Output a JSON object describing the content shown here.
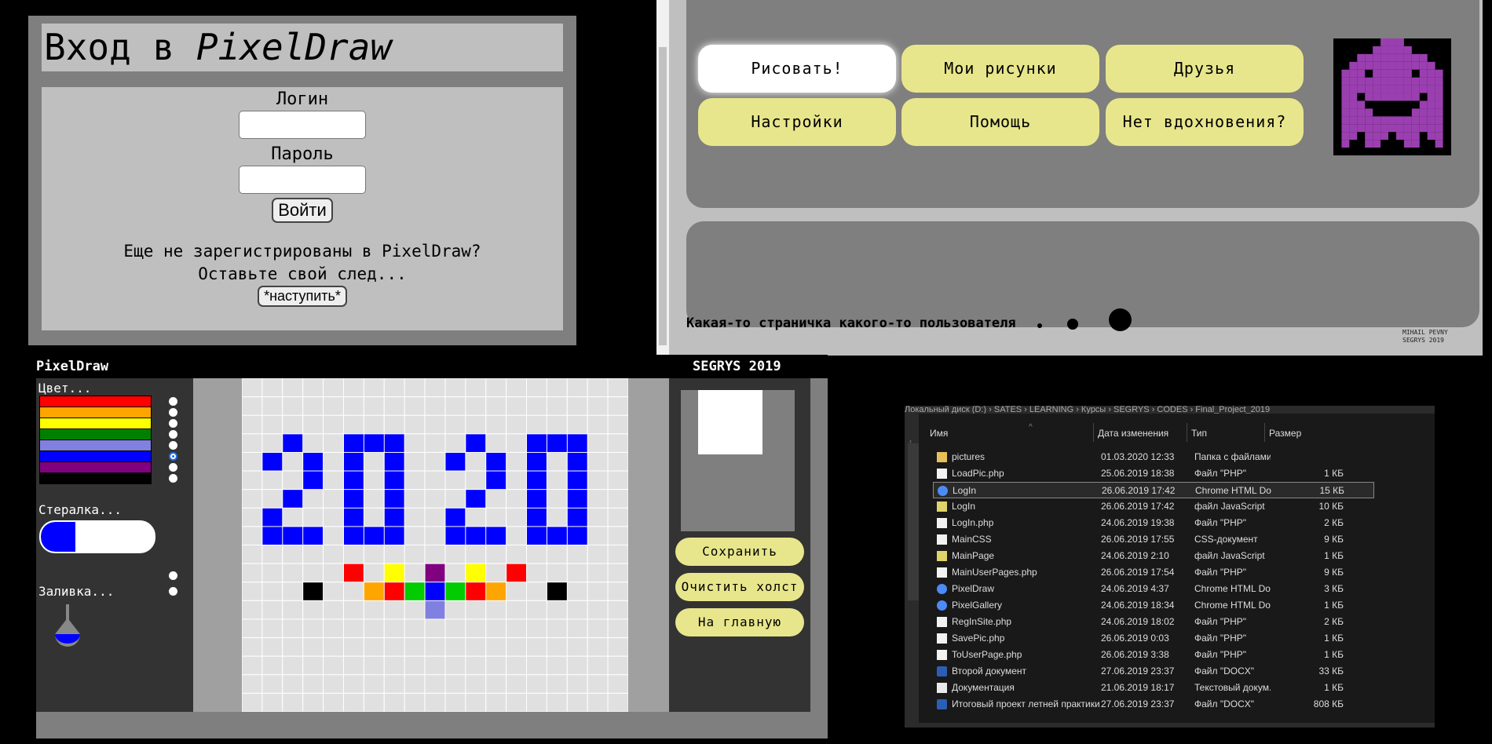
{
  "login": {
    "title_plain": "Вход в ",
    "title_italic": "PixelDraw",
    "login_label": "Логин",
    "password_label": "Пароль",
    "submit_label": "Войти",
    "register_line1": "Еще не зарегистрированы в PixelDraw?",
    "register_line2": "Оставьте свой след...",
    "register_button": "*наступить*"
  },
  "main": {
    "menu": [
      "Рисовать!",
      "Мои рисунки",
      "Друзья",
      "Настройки",
      "Помощь",
      "Нет вдохновения?"
    ],
    "active_menu_index": 0,
    "avatar_color": "#9a3fb0",
    "footer_text": "Какая-то страничка какого-то пользователя",
    "author_line1": "MIHAIL PEVNY",
    "author_line2": "SEGRYS 2019"
  },
  "draw": {
    "app_name": "PixelDraw",
    "header_right": "SEGRYS 2019",
    "color_label": "Цвет...",
    "eraser_label": "Стералка...",
    "fill_label": "Заливка...",
    "palette": [
      "#ff0000",
      "#ffa500",
      "#ffff00",
      "#008000",
      "#8080e0",
      "#0000ff",
      "#800080",
      "#000000"
    ],
    "selected_color_index": 5,
    "save_button": "Сохранить",
    "clear_button": "Очистить холст",
    "home_button": "На главную",
    "canvas_grid": {
      "cols": 19,
      "rows": 18
    },
    "pixels": [
      {
        "c": 2,
        "r": 3,
        "color": "#0000ff"
      },
      {
        "c": 1,
        "r": 4,
        "color": "#0000ff"
      },
      {
        "c": 3,
        "r": 4,
        "color": "#0000ff"
      },
      {
        "c": 3,
        "r": 5,
        "color": "#0000ff"
      },
      {
        "c": 2,
        "r": 6,
        "color": "#0000ff"
      },
      {
        "c": 1,
        "r": 7,
        "color": "#0000ff"
      },
      {
        "c": 1,
        "r": 8,
        "color": "#0000ff"
      },
      {
        "c": 2,
        "r": 8,
        "color": "#0000ff"
      },
      {
        "c": 3,
        "r": 8,
        "color": "#0000ff"
      },
      {
        "c": 5,
        "r": 3,
        "color": "#0000ff"
      },
      {
        "c": 6,
        "r": 3,
        "color": "#0000ff"
      },
      {
        "c": 7,
        "r": 3,
        "color": "#0000ff"
      },
      {
        "c": 5,
        "r": 4,
        "color": "#0000ff"
      },
      {
        "c": 7,
        "r": 4,
        "color": "#0000ff"
      },
      {
        "c": 5,
        "r": 5,
        "color": "#0000ff"
      },
      {
        "c": 7,
        "r": 5,
        "color": "#0000ff"
      },
      {
        "c": 5,
        "r": 6,
        "color": "#0000ff"
      },
      {
        "c": 7,
        "r": 6,
        "color": "#0000ff"
      },
      {
        "c": 5,
        "r": 7,
        "color": "#0000ff"
      },
      {
        "c": 7,
        "r": 7,
        "color": "#0000ff"
      },
      {
        "c": 5,
        "r": 8,
        "color": "#0000ff"
      },
      {
        "c": 6,
        "r": 8,
        "color": "#0000ff"
      },
      {
        "c": 7,
        "r": 8,
        "color": "#0000ff"
      },
      {
        "c": 11,
        "r": 3,
        "color": "#0000ff"
      },
      {
        "c": 10,
        "r": 4,
        "color": "#0000ff"
      },
      {
        "c": 12,
        "r": 4,
        "color": "#0000ff"
      },
      {
        "c": 12,
        "r": 5,
        "color": "#0000ff"
      },
      {
        "c": 11,
        "r": 6,
        "color": "#0000ff"
      },
      {
        "c": 10,
        "r": 7,
        "color": "#0000ff"
      },
      {
        "c": 10,
        "r": 8,
        "color": "#0000ff"
      },
      {
        "c": 11,
        "r": 8,
        "color": "#0000ff"
      },
      {
        "c": 12,
        "r": 8,
        "color": "#0000ff"
      },
      {
        "c": 14,
        "r": 3,
        "color": "#0000ff"
      },
      {
        "c": 15,
        "r": 3,
        "color": "#0000ff"
      },
      {
        "c": 16,
        "r": 3,
        "color": "#0000ff"
      },
      {
        "c": 14,
        "r": 4,
        "color": "#0000ff"
      },
      {
        "c": 16,
        "r": 4,
        "color": "#0000ff"
      },
      {
        "c": 14,
        "r": 5,
        "color": "#0000ff"
      },
      {
        "c": 16,
        "r": 5,
        "color": "#0000ff"
      },
      {
        "c": 14,
        "r": 6,
        "color": "#0000ff"
      },
      {
        "c": 16,
        "r": 6,
        "color": "#0000ff"
      },
      {
        "c": 14,
        "r": 7,
        "color": "#0000ff"
      },
      {
        "c": 16,
        "r": 7,
        "color": "#0000ff"
      },
      {
        "c": 14,
        "r": 8,
        "color": "#0000ff"
      },
      {
        "c": 15,
        "r": 8,
        "color": "#0000ff"
      },
      {
        "c": 16,
        "r": 8,
        "color": "#0000ff"
      },
      {
        "c": 5,
        "r": 10,
        "color": "#ff0000"
      },
      {
        "c": 7,
        "r": 10,
        "color": "#ffff00"
      },
      {
        "c": 9,
        "r": 10,
        "color": "#800080"
      },
      {
        "c": 11,
        "r": 10,
        "color": "#ffff00"
      },
      {
        "c": 13,
        "r": 10,
        "color": "#ff0000"
      },
      {
        "c": 3,
        "r": 11,
        "color": "#000000"
      },
      {
        "c": 6,
        "r": 11,
        "color": "#ffa500"
      },
      {
        "c": 7,
        "r": 11,
        "color": "#ff0000"
      },
      {
        "c": 8,
        "r": 11,
        "color": "#00cc00"
      },
      {
        "c": 9,
        "r": 11,
        "color": "#0000ff"
      },
      {
        "c": 10,
        "r": 11,
        "color": "#00cc00"
      },
      {
        "c": 11,
        "r": 11,
        "color": "#ff0000"
      },
      {
        "c": 12,
        "r": 11,
        "color": "#ffa500"
      },
      {
        "c": 15,
        "r": 11,
        "color": "#000000"
      },
      {
        "c": 9,
        "r": 12,
        "color": "#8080e0"
      }
    ]
  },
  "explorer": {
    "breadcrumb": "Локальный диск (D:) › SATES › LEARNING › Курсы › SEGRYS › CODES › Final_Project_2019",
    "headers": [
      "Имя",
      "Дата изменения",
      "Тип",
      "Размер"
    ],
    "selected_index": 2,
    "files": [
      {
        "name": "pictures",
        "date": "01.03.2020 12:33",
        "type": "Папка с файлами",
        "size": "",
        "icon": "folder-icon"
      },
      {
        "name": "LoadPic.php",
        "date": "25.06.2019 18:38",
        "type": "Файл \"PHP\"",
        "size": "1 КБ",
        "icon": "file-icon"
      },
      {
        "name": "LogIn",
        "date": "26.06.2019 17:42",
        "type": "Chrome HTML Do...",
        "size": "15 КБ",
        "icon": "chrome-icon"
      },
      {
        "name": "LogIn",
        "date": "26.06.2019 17:42",
        "type": "файл JavaScript",
        "size": "10 КБ",
        "icon": "js-icon"
      },
      {
        "name": "LogIn.php",
        "date": "24.06.2019 19:38",
        "type": "Файл \"PHP\"",
        "size": "2 КБ",
        "icon": "file-icon"
      },
      {
        "name": "MainCSS",
        "date": "26.06.2019 17:55",
        "type": "CSS-документ",
        "size": "9 КБ",
        "icon": "file-icon"
      },
      {
        "name": "MainPage",
        "date": "24.06.2019 2:10",
        "type": "файл JavaScript",
        "size": "1 КБ",
        "icon": "js-icon"
      },
      {
        "name": "MainUserPages.php",
        "date": "26.06.2019 17:54",
        "type": "Файл \"PHP\"",
        "size": "9 КБ",
        "icon": "file-icon"
      },
      {
        "name": "PixelDraw",
        "date": "24.06.2019 4:37",
        "type": "Chrome HTML Do...",
        "size": "3 КБ",
        "icon": "chrome-icon"
      },
      {
        "name": "PixelGallery",
        "date": "24.06.2019 18:34",
        "type": "Chrome HTML Do...",
        "size": "1 КБ",
        "icon": "chrome-icon"
      },
      {
        "name": "RegInSite.php",
        "date": "24.06.2019 18:02",
        "type": "Файл \"PHP\"",
        "size": "2 КБ",
        "icon": "file-icon"
      },
      {
        "name": "SavePic.php",
        "date": "26.06.2019 0:03",
        "type": "Файл \"PHP\"",
        "size": "1 КБ",
        "icon": "file-icon"
      },
      {
        "name": "ToUserPage.php",
        "date": "26.06.2019 3:38",
        "type": "Файл \"PHP\"",
        "size": "1 КБ",
        "icon": "file-icon"
      },
      {
        "name": "Второй документ",
        "date": "27.06.2019 23:37",
        "type": "Файл \"DOCX\"",
        "size": "33 КБ",
        "icon": "word-icon"
      },
      {
        "name": "Документация",
        "date": "21.06.2019 18:17",
        "type": "Текстовый докум...",
        "size": "1 КБ",
        "icon": "text-icon"
      },
      {
        "name": "Итоговый проект летней практики СЕГ...",
        "date": "27.06.2019 23:37",
        "type": "Файл \"DOCX\"",
        "size": "808 КБ",
        "icon": "word-icon"
      }
    ]
  }
}
